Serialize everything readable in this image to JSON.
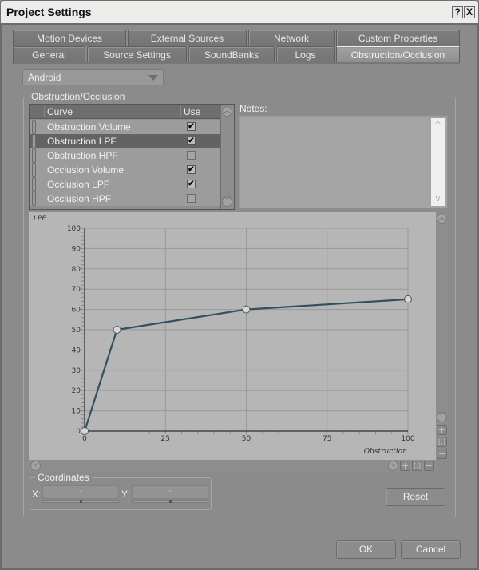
{
  "window": {
    "title": "Project Settings",
    "help_icon": "?",
    "close_icon": "X"
  },
  "tabs": {
    "row_top": [
      {
        "label": "Motion Devices"
      },
      {
        "label": "External Sources"
      },
      {
        "label": "Network"
      },
      {
        "label": "Custom Properties"
      }
    ],
    "row_bottom": [
      {
        "label": "General"
      },
      {
        "label": "Source Settings"
      },
      {
        "label": "SoundBanks"
      },
      {
        "label": "Logs"
      },
      {
        "label": "Obstruction/Occlusion",
        "active": true
      }
    ]
  },
  "platform_dropdown": {
    "selected": "Android"
  },
  "obstruction_group": {
    "label": "Obstruction/Occlusion",
    "table": {
      "columns": [
        "Curve",
        "Use"
      ],
      "rows": [
        {
          "name": "Obstruction Volume",
          "use": true,
          "selected": false
        },
        {
          "name": "Obstruction LPF",
          "use": true,
          "selected": true
        },
        {
          "name": "Obstruction HPF",
          "use": false,
          "selected": false
        },
        {
          "name": "Occlusion Volume",
          "use": true,
          "selected": false
        },
        {
          "name": "Occlusion LPF",
          "use": true,
          "selected": false
        },
        {
          "name": "Occlusion HPF",
          "use": false,
          "selected": false
        }
      ],
      "check_glyph": "✔"
    },
    "notes": {
      "label": "Notes:",
      "value": ""
    }
  },
  "chart_data": {
    "type": "line",
    "title": "",
    "ylabel": "LPF",
    "xlabel": "Obstruction",
    "xlim": [
      0,
      100
    ],
    "ylim": [
      0,
      100
    ],
    "x_ticks": [
      0,
      25,
      50,
      75,
      100
    ],
    "y_ticks": [
      0,
      10,
      20,
      30,
      40,
      50,
      60,
      70,
      80,
      90,
      100
    ],
    "grid": true,
    "series": [
      {
        "name": "Obstruction LPF",
        "color": "#34505f",
        "points": [
          [
            0,
            0
          ],
          [
            10,
            50
          ],
          [
            50,
            60
          ],
          [
            100,
            65
          ]
        ]
      }
    ]
  },
  "graph_controls": {
    "zoom_in": "+",
    "zoom_fit": "[:]",
    "zoom_out": "−"
  },
  "coordinates": {
    "label": "Coordinates",
    "x_label": "X:",
    "x_value": "-",
    "y_label": "Y:",
    "y_value": "-"
  },
  "buttons": {
    "reset_first": "R",
    "reset_rest": "eset",
    "ok": "OK",
    "cancel": "Cancel"
  }
}
